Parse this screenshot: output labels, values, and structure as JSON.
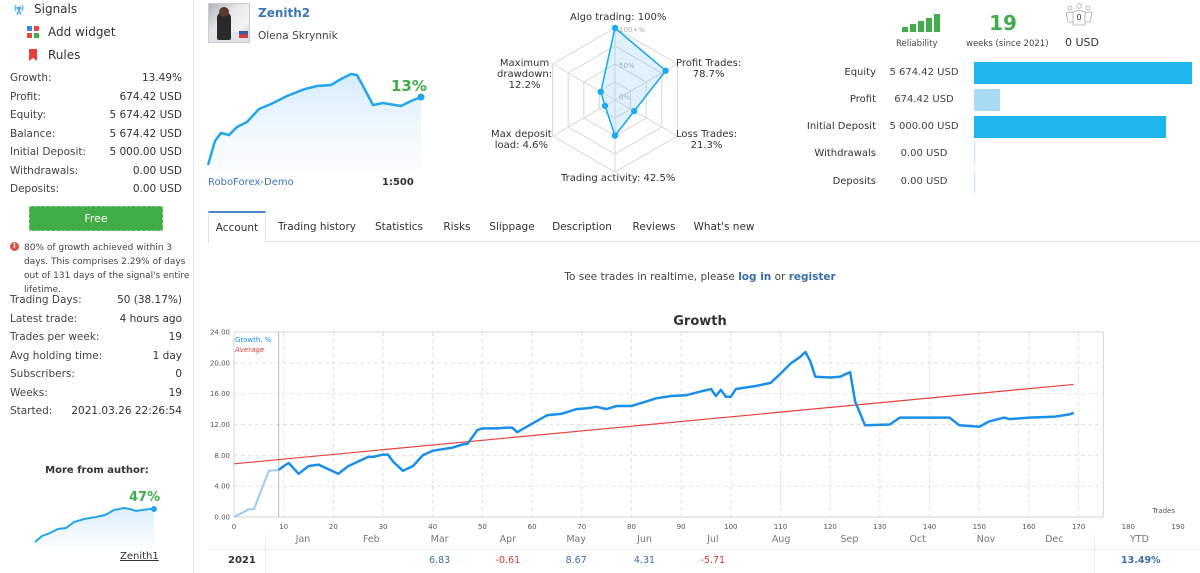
{
  "sidebar": {
    "nav": [
      {
        "label": "Signals",
        "icon": "signals-antenna-icon"
      },
      {
        "label": "Add widget",
        "icon": "widget-icon"
      },
      {
        "label": "Rules",
        "icon": "bookmark-icon"
      }
    ],
    "stats": [
      {
        "label": "Growth:",
        "value": "13.49%"
      },
      {
        "label": "Profit:",
        "value": "674.42 USD"
      },
      {
        "label": "Equity:",
        "value": "5 674.42 USD"
      },
      {
        "label": "Balance:",
        "value": "5 674.42 USD"
      },
      {
        "label": "Initial Deposit:",
        "value": "5 000.00 USD"
      },
      {
        "label": "Withdrawals:",
        "value": "0.00 USD"
      },
      {
        "label": "Deposits:",
        "value": "0.00 USD"
      }
    ],
    "free_button": "Free",
    "notice": "80% of growth achieved within 3 days. This comprises 2.29% of days out of 131 days of the signal's entire lifetime.",
    "stats2": [
      {
        "label": "Trading Days:",
        "value": "50 (38.17%)"
      },
      {
        "label": "Latest trade:",
        "value": "4 hours ago"
      },
      {
        "label": "Trades per week:",
        "value": "19"
      },
      {
        "label": "Avg holding time:",
        "value": "1 day"
      },
      {
        "label": "Subscribers:",
        "value": "0"
      },
      {
        "label": "Weeks:",
        "value": "19"
      },
      {
        "label": "Started:",
        "value": "2021.03.26 22:26:54"
      }
    ],
    "more_from_author": "More from author:",
    "other_signal": {
      "name": "Zenith1",
      "growth": "47%"
    }
  },
  "profile": {
    "signal_name": "Zenith2",
    "author": "Olena Skrynnik",
    "growth": "13%",
    "broker": "RoboForex-Demo",
    "leverage": "1:500"
  },
  "radar": {
    "axes": [
      {
        "label": "Algo trading: 100%",
        "value": 100
      },
      {
        "label": "Profit Trades:\n78.7%",
        "value": 78.7
      },
      {
        "label": "Loss Trades:\n21.3%",
        "value": 21.3
      },
      {
        "label": "Trading activity: 42.5%",
        "value": 42.5
      },
      {
        "label": "Max deposit\nload: 4.6%",
        "value": 4.6
      },
      {
        "label": "Maximum\ndrawdown:\n12.2%",
        "value": 12.2
      }
    ],
    "ring_labels": [
      "100+%",
      "50%",
      "0%"
    ]
  },
  "summary": {
    "reliability_label": "Reliability",
    "reliability_level": 5,
    "weeks": "19",
    "weeks_label": "weeks (since 2021)",
    "subscribers_count": "0",
    "subscribers_usd": "0 USD",
    "bars": [
      {
        "label": "Equity",
        "value": "5 674.42 USD",
        "amount": 5674.42
      },
      {
        "label": "Profit",
        "value": "674.42 USD",
        "amount": 674.42
      },
      {
        "label": "Initial Deposit",
        "value": "5 000.00 USD",
        "amount": 5000.0
      },
      {
        "label": "Withdrawals",
        "value": "0.00 USD",
        "amount": 0
      },
      {
        "label": "Deposits",
        "value": "0.00 USD",
        "amount": 0
      }
    ]
  },
  "tabs": [
    {
      "label": "Account",
      "active": true
    },
    {
      "label": "Trading history"
    },
    {
      "label": "Statistics"
    },
    {
      "label": "Risks"
    },
    {
      "label": "Slippage"
    },
    {
      "label": "Description"
    },
    {
      "label": "Reviews"
    },
    {
      "label": "What's new"
    }
  ],
  "realtime": {
    "prefix": "To see trades in realtime, please ",
    "login": "log in",
    "or": " or ",
    "register": "register"
  },
  "chart_data": {
    "type": "line",
    "title": "Growth",
    "xlabel": "Trades",
    "ylabel": "",
    "xlim": [
      0,
      190
    ],
    "ylim": [
      0,
      24
    ],
    "xticks": [
      0,
      10,
      20,
      30,
      40,
      50,
      60,
      70,
      80,
      90,
      100,
      110,
      120,
      130,
      140,
      150,
      160,
      170,
      180,
      190
    ],
    "yticks": [
      "0.00",
      "4.00",
      "8.00",
      "12.00",
      "16.00",
      "20.00",
      "24.00"
    ],
    "grid": true,
    "legend": "top-left",
    "series": [
      {
        "name": "Growth, %",
        "color": "#1b8fe8",
        "x": [
          0,
          3,
          4,
          7,
          9,
          10,
          11,
          13,
          15,
          17,
          19,
          21,
          23,
          25,
          27,
          28,
          30,
          31,
          32,
          34,
          36,
          38,
          40,
          42,
          44,
          46,
          47,
          49,
          50,
          53,
          55,
          56,
          57,
          60,
          63,
          66,
          68,
          69,
          71,
          73,
          75,
          77,
          80,
          83,
          85,
          88,
          91,
          94,
          96,
          97,
          98,
          99,
          100,
          101,
          105,
          108,
          110,
          112,
          114,
          115,
          116,
          117,
          120,
          122,
          124,
          125,
          127,
          132,
          134,
          136,
          140,
          144,
          146,
          150,
          152,
          155,
          156,
          160,
          165,
          168,
          169
        ],
        "values": [
          0.0,
          1.0,
          1.0,
          6.0,
          6.1,
          6.6,
          7.0,
          5.6,
          6.6,
          6.8,
          6.2,
          5.6,
          6.6,
          7.2,
          7.8,
          7.8,
          8.1,
          8.1,
          7.2,
          6.0,
          6.6,
          8.0,
          8.6,
          8.8,
          9.0,
          9.4,
          9.5,
          11.3,
          11.5,
          11.5,
          11.6,
          11.6,
          11.0,
          12.1,
          13.2,
          13.4,
          13.8,
          14.0,
          14.1,
          14.3,
          14.0,
          14.4,
          14.4,
          15.0,
          15.4,
          15.7,
          15.8,
          16.3,
          16.6,
          15.7,
          16.5,
          15.6,
          15.6,
          16.6,
          17.0,
          17.4,
          18.6,
          19.9,
          20.8,
          21.4,
          20.2,
          18.2,
          18.1,
          18.2,
          18.8,
          15.0,
          11.9,
          12.0,
          12.9,
          12.9,
          12.9,
          12.9,
          11.9,
          11.7,
          12.4,
          12.9,
          12.7,
          12.9,
          13.0,
          13.3,
          13.5
        ]
      },
      {
        "name": "Average",
        "color": "#e8413b",
        "x": [
          0,
          169
        ],
        "values": [
          6.9,
          17.2
        ]
      }
    ],
    "highlight_x": 9
  },
  "monthly": {
    "year": "2021",
    "months": [
      "Jan",
      "Feb",
      "Mar",
      "Apr",
      "May",
      "Jun",
      "Jul",
      "Aug",
      "Sep",
      "Oct",
      "Nov",
      "Dec"
    ],
    "values": [
      "",
      "",
      "6.83",
      "-0.61",
      "8.67",
      "4.31",
      "-5.71",
      "",
      "",
      "",
      "",
      ""
    ],
    "ytd_label": "YTD",
    "ytd": "13.49%"
  }
}
